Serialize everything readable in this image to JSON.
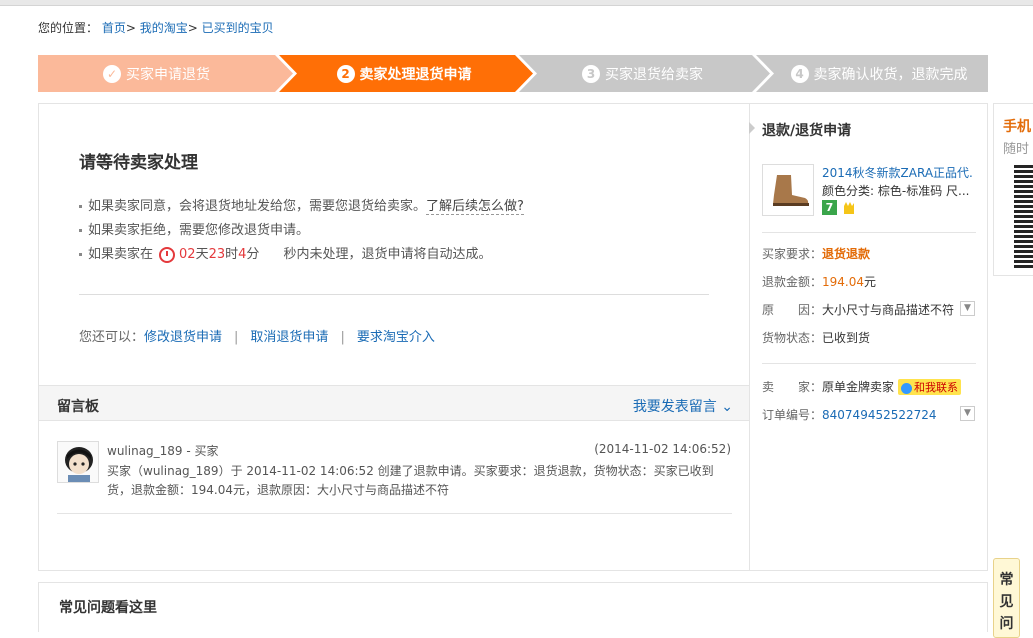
{
  "breadcrumb": {
    "label": "您的位置：",
    "items": [
      "首页",
      "我的淘宝",
      "已买到的宝贝"
    ],
    "sep": ">"
  },
  "steps": [
    {
      "num": "✓",
      "label": "买家申请退货",
      "state": "done",
      "color": "#fbb99a"
    },
    {
      "num": "2",
      "label": "卖家处理退货申请",
      "state": "current",
      "color": "#ff6f06"
    },
    {
      "num": "3",
      "label": "买家退货给卖家",
      "state": "todo",
      "color": "#c8c8c8"
    },
    {
      "num": "4",
      "label": "卖家确认收货，退款完成",
      "state": "todo",
      "color": "#c8c8c8"
    }
  ],
  "status": {
    "title": "请等待卖家处理",
    "line1": "如果卖家同意，会将退货地址发给您，需要您退货给卖家。",
    "line1_link": "了解后续怎么做?",
    "line2": "如果卖家拒绝，需要您修改退货申请。",
    "line3_pre": "如果卖家在",
    "timer": {
      "days": "02",
      "days_unit": "天",
      "hours": "23",
      "hours_unit": "时",
      "minutes": "4",
      "minutes_unit": "分",
      "seconds_unit": "秒"
    },
    "line3_post": "内未处理，退货申请将自动达成。"
  },
  "actions": {
    "label": "您还可以：",
    "modify": "修改退货申请",
    "cancel": "取消退货申请",
    "intervene": "要求淘宝介入",
    "bar": "|"
  },
  "board": {
    "title": "留言板",
    "post": "我要发表留言",
    "message": {
      "user": "wulinag_189 - 买家",
      "time": "(2014-11-02 14:06:52)",
      "body": "买家（wulinag_189）于 2014-11-02 14:06:52 创建了退款申请。买家要求：退货退款，货物状态：买家已收到货，退款金额：194.04元，退款原因：大小尺寸与商品描述不符"
    }
  },
  "sidebar": {
    "title": "退款/退货申请",
    "product_name": "2014秋冬新款ZARA正品代...",
    "product_attr": "颜色分类: 棕色-标准码 尺...",
    "badge": "7",
    "req_label": "买家要求：",
    "req_value": "退货退款",
    "amount_label": "退款金额：",
    "amount_value": "194.04",
    "amount_unit": "元",
    "reason_label": "原　　因：",
    "reason_value": "大小尺寸与商品描述不符",
    "goods_label": "货物状态：",
    "goods_value": "已收到货",
    "seller_label": "卖　　家：",
    "seller_value": "原单金牌卖家",
    "contact": "和我联系",
    "order_label": "订单编号：",
    "order_value": "840749452522724"
  },
  "faq": {
    "title": "常见问题看这里",
    "tab": "常见问"
  },
  "side": {
    "title": "手机",
    "sub": "随时"
  },
  "colors": {
    "link": "#1a6bb5",
    "orange": "#e36c09",
    "red": "#e4393c"
  }
}
